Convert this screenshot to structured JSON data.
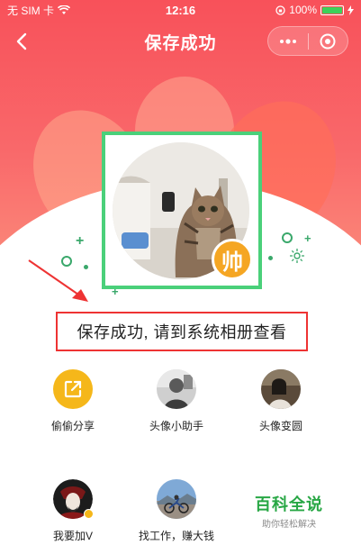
{
  "status_bar": {
    "carrier": "无 SIM 卡",
    "time": "12:16",
    "battery": "100%",
    "battery_level": 1.0
  },
  "nav": {
    "title": "保存成功",
    "back_icon": "chevron-left-icon",
    "more_icon": "more-dots-icon",
    "close_icon": "target-circle-icon"
  },
  "avatar": {
    "badge_text": "帅"
  },
  "message": "保存成功, 请到系统相册查看",
  "grid": [
    {
      "label": "偷偷分享",
      "icon": "share-icon"
    },
    {
      "label": "头像小助手",
      "icon": "assistant-avatar-icon"
    },
    {
      "label": "头像变圆",
      "icon": "round-avatar-icon"
    },
    {
      "label": "我要加V",
      "icon": "v-badge-avatar-icon"
    },
    {
      "label": "找工作，赚大钱",
      "icon": "job-avatar-icon"
    }
  ],
  "watermark": {
    "title": "百科全说",
    "subtitle": "助你轻松解决"
  },
  "colors": {
    "hero": "#f8515a",
    "frame": "#4ad07a",
    "highlight": "#e33333",
    "badge": "#f5a623",
    "watermark": "#28a745"
  }
}
